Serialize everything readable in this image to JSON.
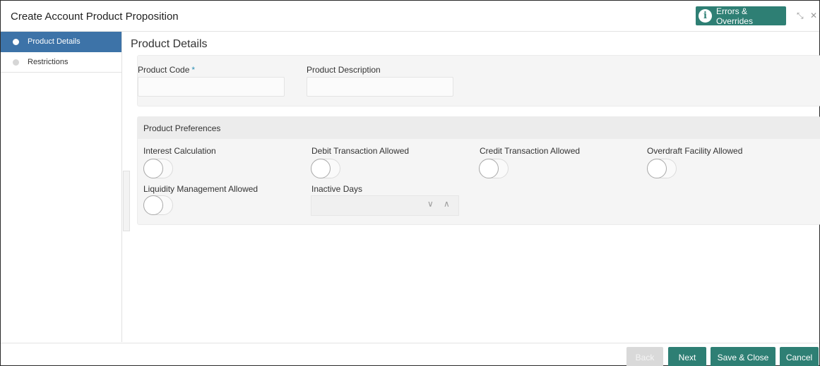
{
  "window": {
    "title": "Create Account Product Proposition",
    "errors_label": "Errors & Overrides",
    "errors_icon": "info-icon",
    "info_glyph": "i",
    "restore_icon": "restore-icon",
    "restore_glyph": "⤡",
    "close_icon": "close-icon",
    "close_glyph": "✕"
  },
  "sidebar": {
    "items": [
      {
        "label": "Product Details",
        "active": true
      },
      {
        "label": "Restrictions",
        "active": false
      }
    ]
  },
  "main": {
    "title": "Product Details",
    "fields": {
      "product_code": {
        "label": "Product Code",
        "required_mark": "*",
        "value": ""
      },
      "product_description": {
        "label": "Product Description",
        "value": ""
      }
    },
    "preferences": {
      "title": "Product Preferences",
      "toggles": [
        {
          "label": "Interest Calculation",
          "on": false
        },
        {
          "label": "Debit Transaction Allowed",
          "on": false
        },
        {
          "label": "Credit Transaction Allowed",
          "on": false
        },
        {
          "label": "Overdraft Facility Allowed",
          "on": false
        },
        {
          "label": "Liquidity Management Allowed",
          "on": false
        }
      ],
      "inactive_days": {
        "label": "Inactive Days",
        "value": "",
        "down_glyph": "∨",
        "up_glyph": "∧"
      }
    }
  },
  "footer": {
    "back": "Back",
    "next": "Next",
    "save_close": "Save & Close",
    "cancel": "Cancel"
  },
  "colors": {
    "accent": "#2e7f74",
    "sidebar_active": "#3d73a8",
    "required": "#2e8fb4"
  }
}
